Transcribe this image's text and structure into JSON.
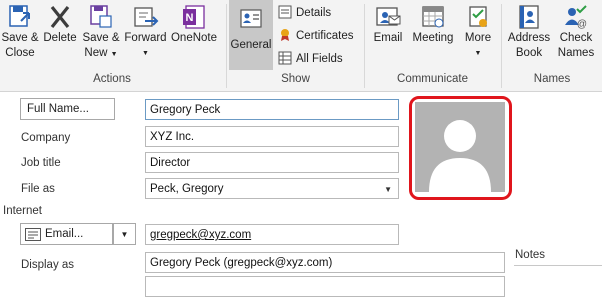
{
  "ribbon": {
    "actions": {
      "group_label": "Actions",
      "save_close": [
        "Save &",
        "Close"
      ],
      "delete": "Delete",
      "save_new": [
        "Save &",
        "New"
      ],
      "forward": "Forward",
      "onenote": "OneNote"
    },
    "show": {
      "group_label": "Show",
      "general": "General",
      "details": "Details",
      "certificates": "Certificates",
      "all_fields": "All Fields"
    },
    "communicate": {
      "group_label": "Communicate",
      "email": "Email",
      "meeting": "Meeting",
      "more": "More"
    },
    "names": {
      "group_label": "Names",
      "address_book": [
        "Address",
        "Book"
      ],
      "check_names": [
        "Check",
        "Names"
      ]
    }
  },
  "form": {
    "full_name_button": "Full Name...",
    "full_name_value": "Gregory Peck",
    "company_label": "Company",
    "company_value": "XYZ Inc.",
    "job_title_label": "Job title",
    "job_title_value": "Director",
    "file_as_label": "File as",
    "file_as_value": "Peck, Gregory",
    "internet_label": "Internet",
    "email_button": "Email...",
    "email_value": "gregpeck@xyz.com",
    "display_as_label": "Display as",
    "display_as_value": "Gregory Peck (gregpeck@xyz.com)",
    "notes_label": "Notes"
  },
  "colors": {
    "photo_highlight": "#e0151c",
    "onenote_purple": "#7b2f9e",
    "accent_blue": "#2b63b3"
  }
}
